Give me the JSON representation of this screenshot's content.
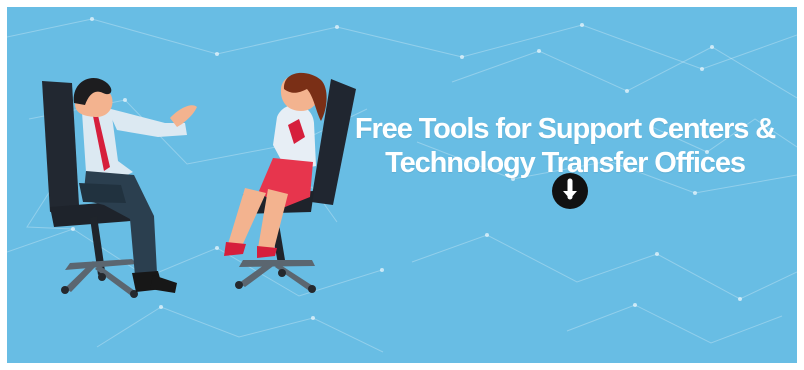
{
  "banner": {
    "headline_line1": "Free Tools for Support Centers &",
    "headline_line2": "Technology Transfer Offices",
    "background_color": "#68bde4",
    "text_color": "#ffffff"
  },
  "illustration": {
    "subject": "two-people-sitting-on-office-chairs-talking",
    "people": [
      "man-in-white-shirt-and-red-tie",
      "woman-in-white-shirt-and-red-skirt"
    ]
  },
  "scroll_down_button": {
    "icon": "arrow-down-circle-icon",
    "background_color": "#111111",
    "icon_color": "#ffffff"
  }
}
